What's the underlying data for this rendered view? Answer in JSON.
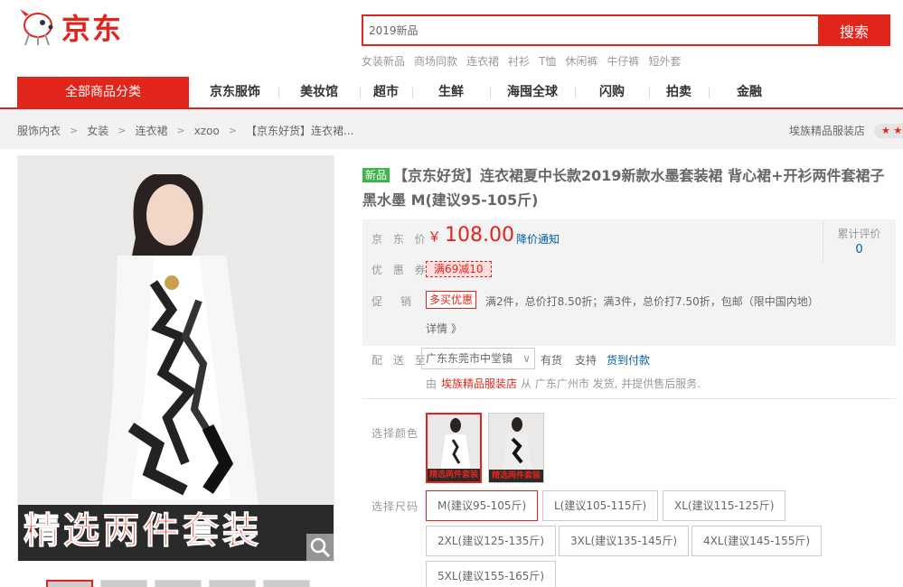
{
  "header": {
    "brand": "京东",
    "search_value": "2019新品",
    "search_button": "搜索",
    "hotwords": [
      "女装新品",
      "商场同款",
      "连衣裙",
      "衬衫",
      "T恤",
      "休闲裤",
      "牛仔裤",
      "短外套"
    ]
  },
  "nav": {
    "category": "全部商品分类",
    "items": [
      "京东服饰",
      "美妆馆",
      "超市",
      "生鲜",
      "海囤全球",
      "闪购",
      "拍卖",
      "金融"
    ]
  },
  "breadcrumb": [
    "服饰内衣",
    "女装",
    "连衣裙",
    "xzoo",
    "【京东好货】连衣裙..."
  ],
  "shop_name": "埃族精品服装店",
  "product": {
    "banner_text": "精选两件套装",
    "new_tag": "新品",
    "title": "【京东好货】连衣裙夏中长款2019新款水墨套装裙 背心裙+开衫两件套裙子 黑水墨 M(建议95-105斤)",
    "price_label": "京 东 价",
    "currency": "￥",
    "price": "108.00",
    "price_notice": "降价通知",
    "review_label": "累计评价",
    "review_count": "0",
    "coupon_label": "优 惠 券",
    "coupon": "满69减10",
    "promo_label": "促　销",
    "promo_tag": "多买优惠",
    "promo_text": "满2件，总价打8.50折；满3件，总价打7.50折，包邮（限中国内地）",
    "details": "详情 》",
    "delivery_label": "配 送 至",
    "delivery_area": "广东东莞市中堂镇",
    "in_stock": "有货",
    "support": "支持",
    "cod": "货到付款",
    "from_prefix": "由",
    "from_shop": "埃族精品服装店",
    "from_suffix": "从 广东广州市 发货, 并提供售后服务.",
    "color_label": "选择颜色",
    "color_caption": "精选两件套装",
    "size_label": "选择尺码",
    "sizes": [
      "M(建议95-105斤)",
      "L(建议105-115斤)",
      "XL(建议115-125斤)",
      "2XL(建议125-135斤)",
      "3XL(建议135-145斤)",
      "4XL(建议145-155斤)",
      "5XL(建议155-165斤)"
    ]
  }
}
